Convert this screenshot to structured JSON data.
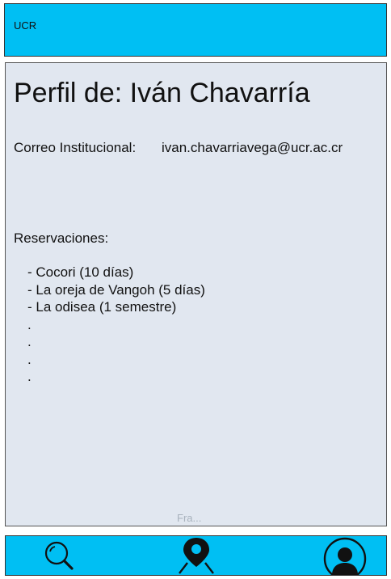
{
  "header": {
    "title": "UCR"
  },
  "profile": {
    "title": "Perfil de: Iván Chavarría",
    "email_label": "Correo Institucional:",
    "email_value": "ivan.chavarriavega@ucr.ac.cr",
    "reservations_label": "Reservaciones:",
    "reservations": [
      "- Cocori (10 días)",
      "- La oreja de Vangoh (5 días)",
      "- La odisea (1 semestre)",
      ".",
      ".",
      ".",
      "."
    ],
    "footer_note": "Fra..."
  },
  "nav": {
    "icons": [
      "search-icon",
      "map-pin-icon",
      "user-profile-icon"
    ],
    "color": "#00bff3"
  },
  "colors": {
    "header_bg": "#00bff3",
    "content_bg": "#e1e7f0"
  }
}
